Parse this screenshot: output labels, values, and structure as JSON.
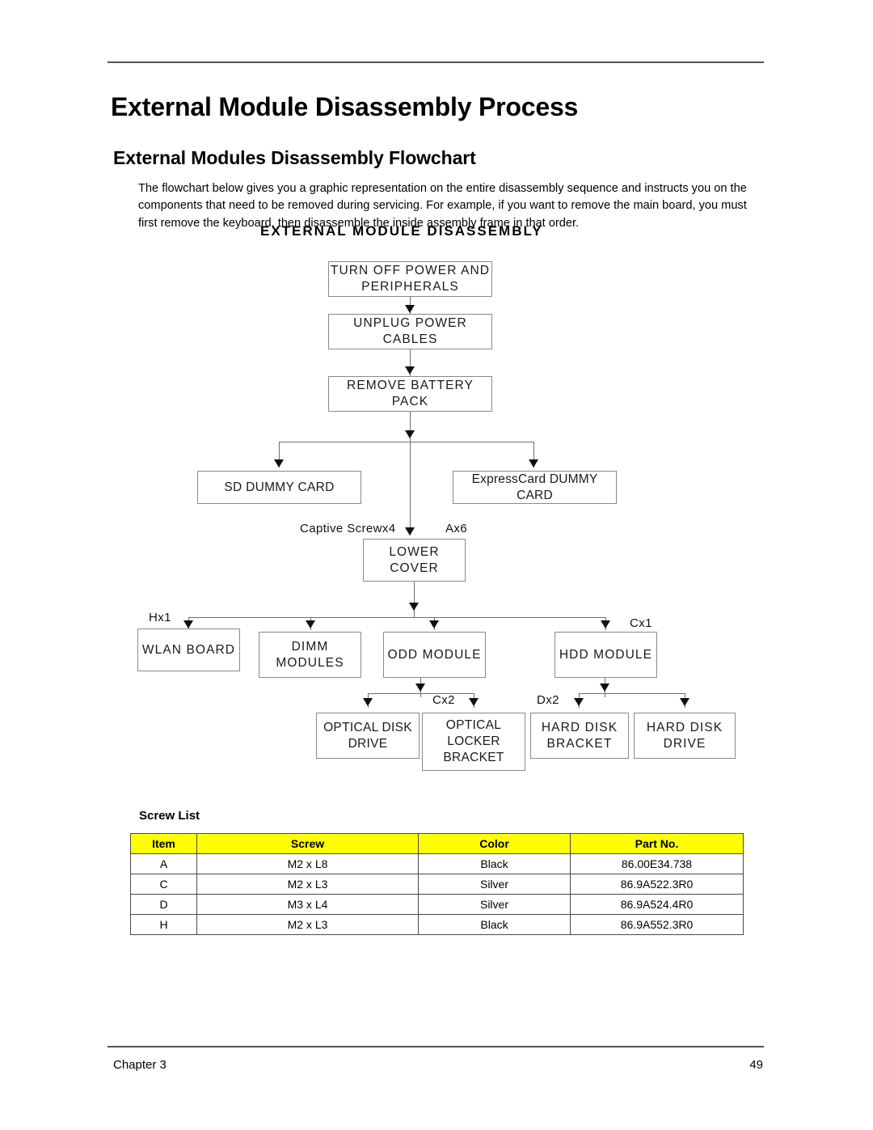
{
  "page": {
    "title": "External Module Disassembly Process",
    "section_title": "External Modules Disassembly Flowchart",
    "intro": "The flowchart below gives you a graphic representation on the entire disassembly sequence and instructs you on the components that need to be removed during servicing. For example, if you want to remove the main board, you must first remove the keyboard, then disassemble the inside assembly frame in that order.",
    "footer_chapter": "Chapter 3",
    "footer_page": "49"
  },
  "flowchart": {
    "title": "EXTERNAL MODULE DISASSEMBLY",
    "nodes": {
      "turn_off_power": "TURN OFF POWER AND PERIPHERALS",
      "unplug_power": "UNPLUG POWER CABLES",
      "remove_battery": "REMOVE BATTERY PACK",
      "sd_dummy_card": "SD DUMMY CARD",
      "expresscard_dummy": "ExpressCard DUMMY CARD",
      "lower_cover": "LOWER COVER",
      "wlan_board": "WLAN BOARD",
      "dimm_modules": "DIMM MODULES",
      "odd_module": "ODD MODULE",
      "hdd_module": "HDD MODULE",
      "optical_disk_drive": "OPTICAL DISK DRIVE",
      "optical_locker_bracket": "OPTICAL LOCKER BRACKET",
      "hard_disk_bracket": "HARD DISK BRACKET",
      "hard_disk_drive": "HARD DISK DRIVE"
    },
    "labels": {
      "captive_screw": "Captive Screwx4",
      "a_x6": "Ax6",
      "h_x1": "Hx1",
      "c_x1": "Cx1",
      "c_x2": "Cx2",
      "d_x2": "Dx2"
    }
  },
  "screw_list": {
    "heading": "Screw List",
    "header_bg": "#FFFF00",
    "columns": [
      "Item",
      "Screw",
      "Color",
      "Part No."
    ],
    "rows": [
      [
        "A",
        "M2 x L8",
        "Black",
        "86.00E34.738"
      ],
      [
        "C",
        "M2 x L3",
        "Silver",
        "86.9A522.3R0"
      ],
      [
        "D",
        "M3 x L4",
        "Silver",
        "86.9A524.4R0"
      ],
      [
        "H",
        "M2 x L3",
        "Black",
        "86.9A552.3R0"
      ]
    ]
  }
}
